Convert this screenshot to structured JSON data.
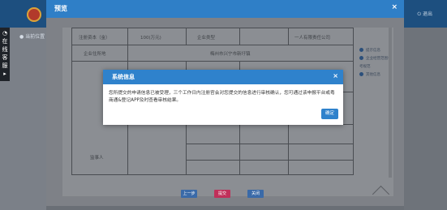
{
  "top": {
    "user_label": "退出"
  },
  "left": {
    "location_text": "当前位置",
    "float_service": [
      "在",
      "线",
      "客",
      "服"
    ]
  },
  "preview": {
    "title": "预览",
    "close": "×",
    "form": {
      "row1": [
        "注册资本（金）",
        "100(万元)",
        "企业类型",
        "一人有限责任公司"
      ],
      "row2": [
        "企业住所地",
        "梅州市兴宁市新圩镇"
      ],
      "person_label": "监事人"
    },
    "side": [
      "提示信息",
      "企业经营范围参考规范",
      "其他信息"
    ],
    "buttons": [
      {
        "label": "上一步",
        "color": "#3a6aa8"
      },
      {
        "label": "提交",
        "color": "#c0305a"
      },
      {
        "label": "关闭",
        "color": "#3a6aa8"
      }
    ]
  },
  "modal": {
    "title": "系统信息",
    "close": "×",
    "message": "您所提交的申请信息已被受理，三个工作日内注册官会对您提交的信息进行审核确认，您可通过该申报平台或粤商通&登记APP及时查看审核结果。",
    "ok_label": "确定"
  }
}
